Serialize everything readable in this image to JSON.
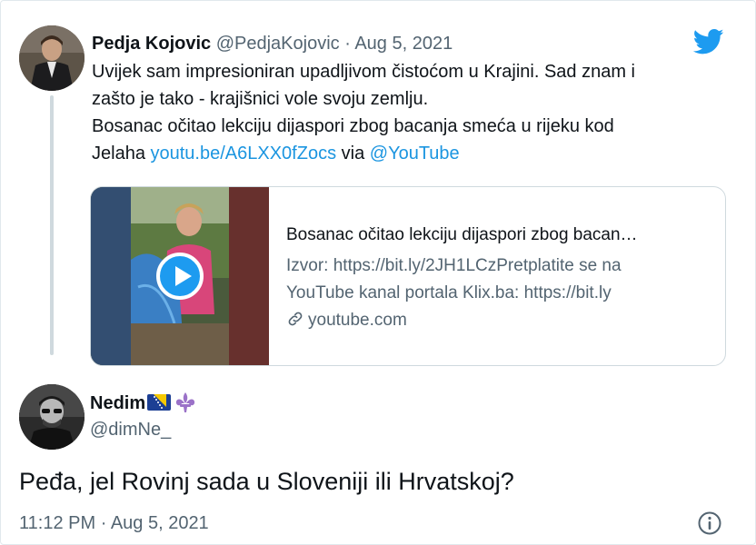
{
  "quoted_tweet": {
    "name": "Pedja Kojovic",
    "handle": "@PedjaKojovic",
    "separator": "·",
    "date": "Aug 5, 2021",
    "text_line1": "Uvijek sam impresioniran upadljivom čistoćom u Krajini. Sad znam i",
    "text_line2": "zašto je tako - krajišnici vole svoju zemlju.",
    "text_line3": "Bosanac očitao lekciju dijaspori zbog bacanja smeća u rijeku kod",
    "text_line4_prefix": "Jelaha ",
    "text_link": "youtu.be/A6LXX0fZocs",
    "text_via": " via ",
    "text_mention": "@YouTube",
    "preview": {
      "title": "Bosanac očitao lekciju dijaspori zbog bacan…",
      "desc_line1": "Izvor: https://bit.ly/2JH1LCzPretplatite se na",
      "desc_line2": "YouTube kanal portala Klix.ba: https://bit.ly",
      "domain": "youtube.com"
    }
  },
  "reply_tweet": {
    "name": "Nedim",
    "handle": "@dimNe_",
    "text": "Peđa, jel Rovinj sada u Sloveniji ili Hrvatskoj?",
    "time": "11:12 PM",
    "separator": "·",
    "date": "Aug 5, 2021"
  },
  "icons": {
    "brand": "twitter-bird-icon",
    "play": "play-icon",
    "link": "link-icon",
    "info": "info-icon",
    "flag": "bosnia-flag-emoji",
    "fleur": "fleur-de-lis-emoji"
  },
  "colors": {
    "link": "#1b95e0",
    "twitter_blue": "#1d9bf0",
    "secondary_text": "#536471",
    "primary_text": "#0f1419"
  }
}
